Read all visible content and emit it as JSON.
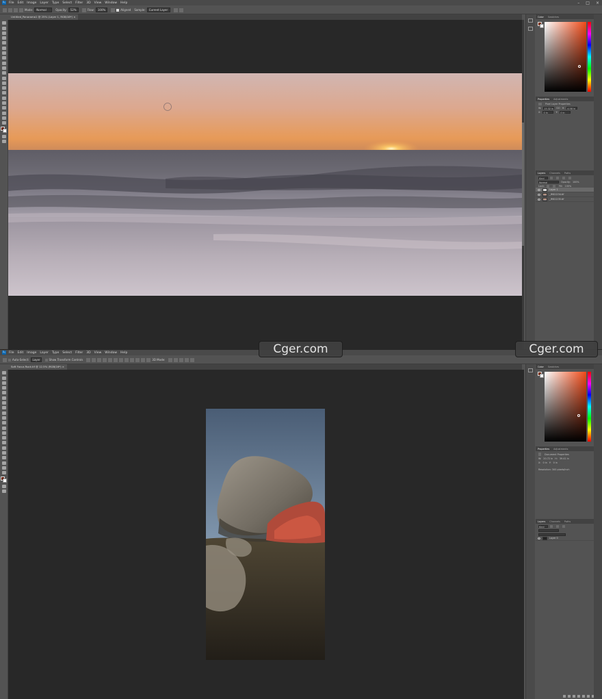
{
  "window_top": {
    "menu": [
      "File",
      "Edit",
      "Image",
      "Layer",
      "Type",
      "Select",
      "Filter",
      "3D",
      "View",
      "Window",
      "Help"
    ],
    "window_controls": [
      "–",
      "□",
      "×"
    ],
    "options": {
      "mode_label": "Mode:",
      "mode_value": "Normal",
      "opacity_label": "Opacity:",
      "opacity_value": "52%",
      "flow_label": "Flow:",
      "flow_value": "100%",
      "aligned_label": "Aligned",
      "sample_label": "Sample:",
      "sample_value": "Current Layer"
    },
    "doc_tab": "Untitled_Panorama1 @ 25% (Layer 1, RGB/16*) ×",
    "properties": {
      "tabs": [
        "Properties",
        "Adjustments"
      ],
      "title": "Pixel Layer Properties",
      "w_label": "W:",
      "w_value": "15.32 in",
      "go_label": "GO",
      "h_label": "H:",
      "h_value": "4.58 in",
      "x_label": "X:",
      "x_value": "0 in",
      "y_label": "Y:",
      "y_value": "0 in"
    },
    "layers": {
      "tabs": [
        "Layers",
        "Channels",
        "Paths"
      ],
      "kind": "Kind",
      "blend": "Normal",
      "opacity_label": "Opacity:",
      "opacity_value": "100%",
      "fill_label": "Fill:",
      "fill_value": "100%",
      "lock_label": "Lock:",
      "items": [
        "Layer 1",
        "_IMG1234.tif",
        "_IMG1235.tif"
      ]
    }
  },
  "window_bottom": {
    "menu": [
      "File",
      "Edit",
      "Image",
      "Layer",
      "Type",
      "Select",
      "Filter",
      "3D",
      "View",
      "Window",
      "Help"
    ],
    "options": {
      "auto_select": "Auto-Select:",
      "layer_value": "Layer",
      "transform_controls": "Show Transform Controls",
      "mode_3d": "3D Mode:"
    },
    "doc_tab": "Soft Focus Rock.tif @ 12.5% (RGB/16*) ×",
    "properties": {
      "tabs": [
        "Properties",
        "Adjustments"
      ],
      "title": "Document Properties",
      "w_label": "W:",
      "w_value": "20.72 in",
      "h_label": "H:",
      "h_value": "39.41 in",
      "x_label": "X:",
      "x_value": "0 in",
      "y_label": "Y:",
      "y_value": "0 in",
      "resolution": "Resolution: 300 pixels/inch"
    },
    "layers": {
      "tabs": [
        "Layers",
        "Channels",
        "Paths"
      ],
      "kind": "Kind",
      "items": [
        "Layer 0"
      ]
    }
  },
  "panel_tabs": {
    "color": "Color",
    "swatches": "Swatches"
  },
  "watermarks": [
    "Cger.com",
    "Cger.com"
  ],
  "colors": {
    "foreground": "#7a2d16",
    "background": "#ffffff",
    "ui_bg": "#535353",
    "canvas_bg": "#282828"
  }
}
